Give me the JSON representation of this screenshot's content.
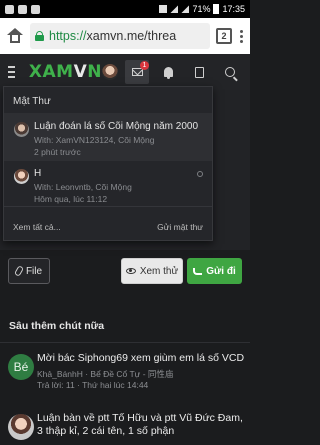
{
  "status_bar": {
    "battery": "71%",
    "time": "17:35"
  },
  "browser": {
    "url_scheme": "https://",
    "url_host": "xamvn.me/threa",
    "tab_count": "2"
  },
  "header": {
    "logo_text": "XAM",
    "logo_v": "V",
    "logo_n": "N",
    "messages_badge": "1"
  },
  "composer": {
    "file_label": "File",
    "preview_label": "Xem thử",
    "send_label": "Gửi đi"
  },
  "messages_dropdown": {
    "title": "Mật Thư",
    "conversations": [
      {
        "title": "Luận đoán lá số Cõi Mộng năm 2000",
        "participants": "With: XamVN123124, Cõi Mộng",
        "time": "2 phút trước"
      },
      {
        "title": "H",
        "participants": "With: Leonvntb, Cõi Mộng",
        "time": "Hôm qua, lúc 11:12"
      }
    ],
    "view_all": "Xem tất cả...",
    "send_message": "Gửi mật thư"
  },
  "related": {
    "title": "Sâu thêm chút nữa",
    "threads": [
      {
        "avatar_text": "Bé",
        "title": "Mời bác Siphong69 xem giùm em lá số VCD",
        "meta_prefix": "Khả_BánhH · Bể Đề Cổ Tự - 同性庙",
        "meta": "Trả lời: 11 · Thứ hai lúc 14:44"
      },
      {
        "avatar_text": "",
        "title": "Luận bàn về ptt Tố Hữu và ptt Vũ Đức Đam, 3 thập kỉ, 2 cái tên, 1 số phận",
        "meta_prefix": "",
        "meta": ""
      }
    ]
  },
  "colors": {
    "brand_green": "#3fb14b",
    "badge_red": "#d9363e",
    "send_green": "#3fa642"
  }
}
